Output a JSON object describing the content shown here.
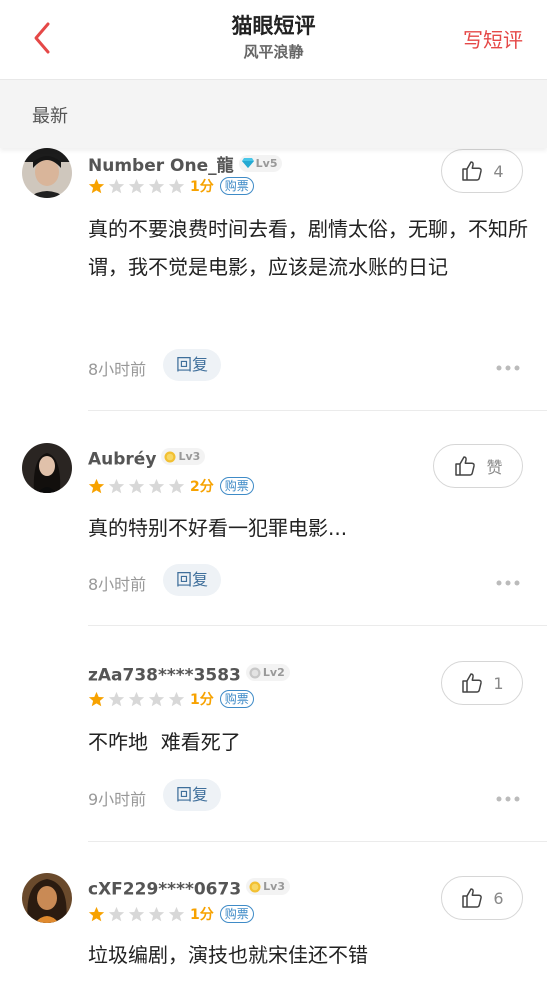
{
  "header": {
    "title": "猫眼短评",
    "subtitle": "风平浪静",
    "write_label": "写短评"
  },
  "filter": {
    "latest_label": "最新"
  },
  "colors": {
    "accent": "#e54847",
    "star": "#f7a200",
    "star_empty": "#d8d8d8",
    "tag_blue": "#3f8bc7"
  },
  "comments": [
    {
      "username": "Number One_龍",
      "level": "Lv5",
      "level_icon": "diamond-icon",
      "rating_stars": 1,
      "score": "1分",
      "tag": "购票",
      "text": "真的不要浪费时间去看，剧情太俗，无聊，不知所谓，我不觉是电影，应该是流水账的日记",
      "time": "8小时前",
      "reply_label": "回复",
      "like_count": "4"
    },
    {
      "username": "Aubréy",
      "level": "Lv3",
      "level_icon": "gold-coin-icon",
      "rating_stars": 1,
      "score": "2分",
      "tag": "购票",
      "text": "真的特别不好看一犯罪电影...",
      "time": "8小时前",
      "reply_label": "回复",
      "like_count": "赞"
    },
    {
      "username": "zAa738****3583",
      "level": "Lv2",
      "level_icon": "silver-coin-icon",
      "rating_stars": 1,
      "score": "1分",
      "tag": "购票",
      "text": "不咋地  难看死了",
      "time": "9小时前",
      "reply_label": "回复",
      "like_count": "1"
    },
    {
      "username": "cXF229****0673",
      "level": "Lv3",
      "level_icon": "gold-coin-icon",
      "rating_stars": 1,
      "score": "1分",
      "tag": "购票",
      "text": "垃圾编剧，演技也就宋佳还不错",
      "like_count": "6"
    }
  ]
}
